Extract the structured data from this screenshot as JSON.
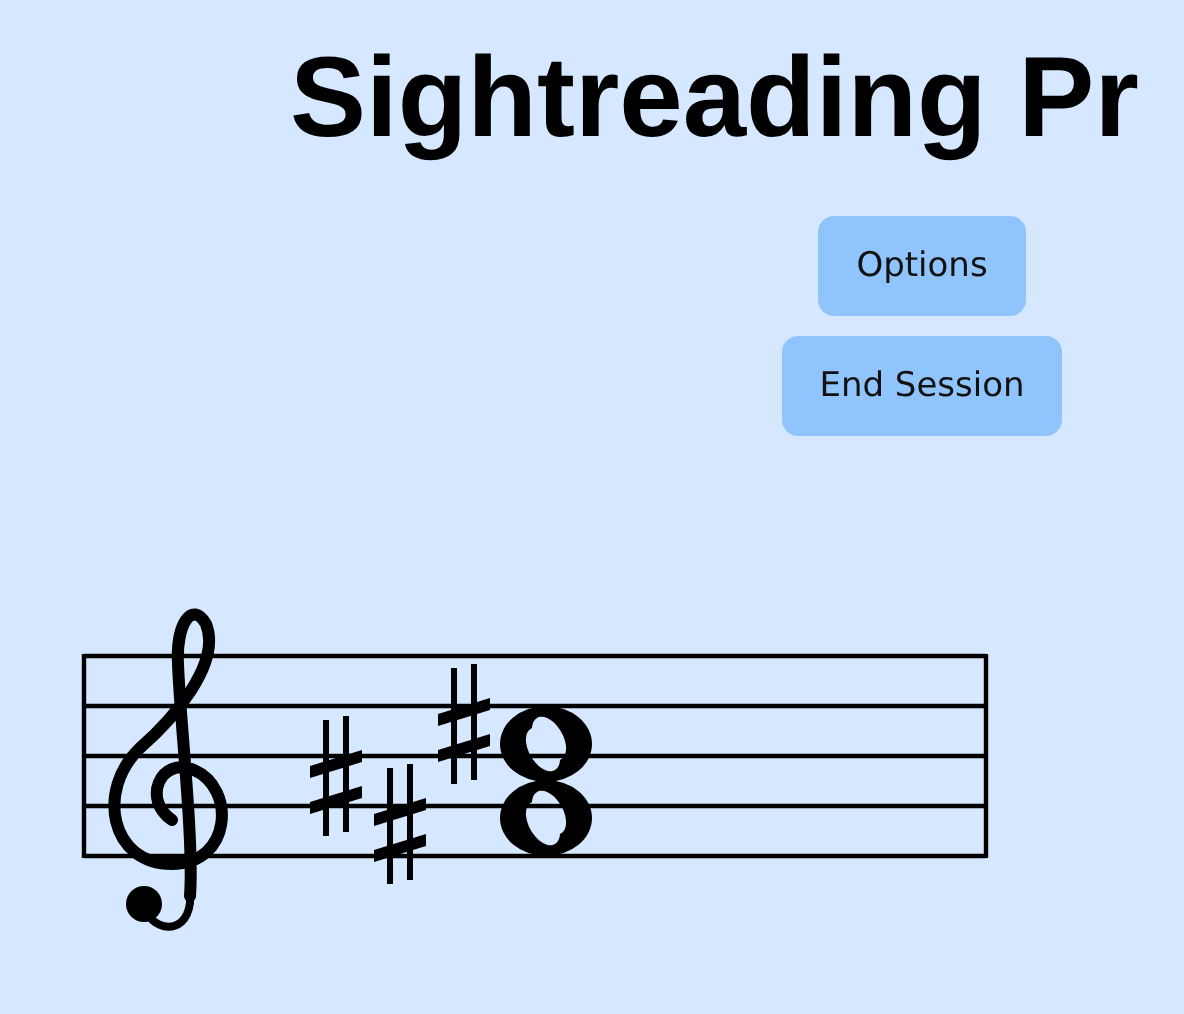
{
  "title": "Sightreading Pr",
  "buttons": [
    {
      "label": "Options"
    },
    {
      "label": "End Session"
    }
  ]
}
